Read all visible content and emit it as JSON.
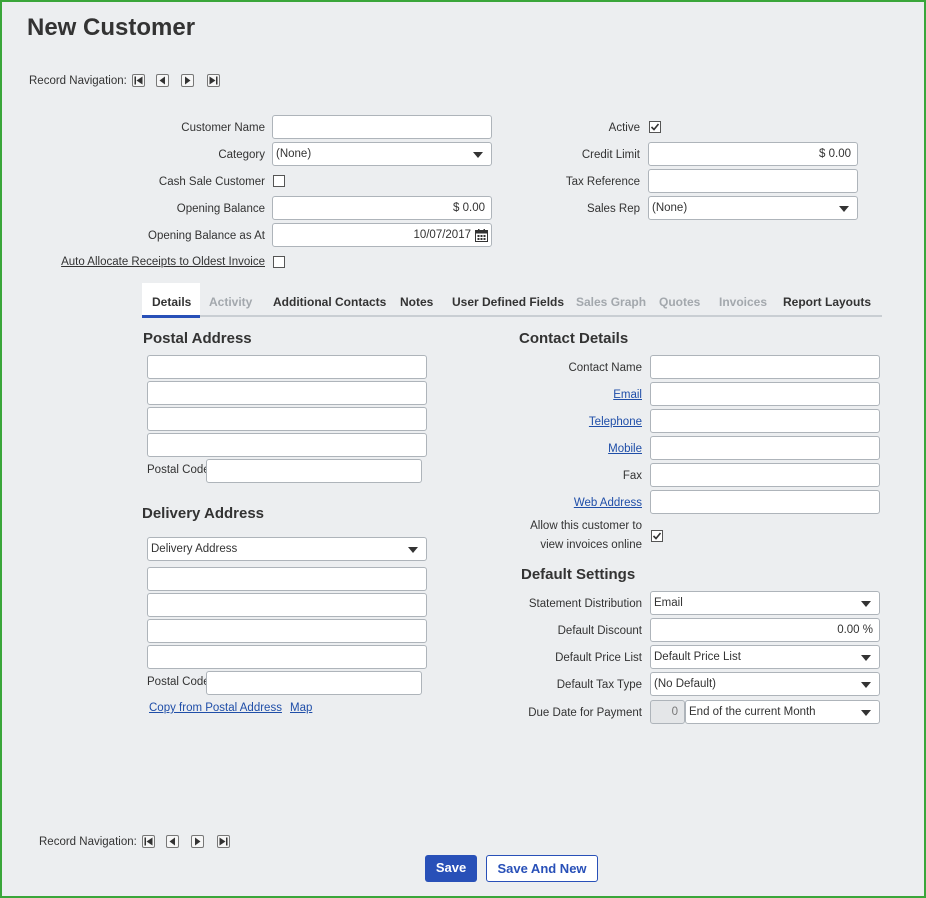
{
  "page": {
    "title": "New Customer"
  },
  "nav": {
    "label": "Record Navigation:"
  },
  "fields": {
    "customer_name": {
      "label": "Customer Name",
      "value": ""
    },
    "category": {
      "label": "Category",
      "value": "(None)"
    },
    "cash_sale": {
      "label": "Cash Sale Customer",
      "checked": false
    },
    "opening_balance": {
      "label": "Opening Balance",
      "value": "$ 0.00"
    },
    "opening_balance_date": {
      "label": "Opening Balance as At",
      "value": "10/07/2017"
    },
    "auto_allocate": {
      "label": "Auto Allocate Receipts to Oldest Invoice",
      "checked": false
    },
    "active": {
      "label": "Active",
      "checked": true
    },
    "credit_limit": {
      "label": "Credit Limit",
      "value": "$ 0.00"
    },
    "tax_reference": {
      "label": "Tax Reference",
      "value": ""
    },
    "sales_rep": {
      "label": "Sales Rep",
      "value": "(None)"
    }
  },
  "tabs": [
    {
      "label": "Details",
      "state": "active"
    },
    {
      "label": "Activity",
      "state": "disabled"
    },
    {
      "label": "Additional Contacts",
      "state": "enabled"
    },
    {
      "label": "Notes",
      "state": "enabled"
    },
    {
      "label": "User Defined Fields",
      "state": "enabled"
    },
    {
      "label": "Sales Graph",
      "state": "disabled"
    },
    {
      "label": "Quotes",
      "state": "disabled"
    },
    {
      "label": "Invoices",
      "state": "disabled"
    },
    {
      "label": "Report Layouts",
      "state": "enabled"
    }
  ],
  "postal": {
    "heading": "Postal Address",
    "postal_code_label": "Postal Code"
  },
  "delivery": {
    "heading": "Delivery Address",
    "select_value": "Delivery Address",
    "postal_code_label": "Postal Code",
    "copy_link": "Copy from Postal Address",
    "map_link": "Map"
  },
  "contact": {
    "heading": "Contact Details",
    "contact_name": "Contact Name",
    "email": "Email",
    "telephone": "Telephone",
    "mobile": "Mobile",
    "fax": "Fax",
    "web_address": "Web Address",
    "allow_online_line1": "Allow this customer to",
    "allow_online_line2": "view invoices online",
    "allow_online_checked": true
  },
  "defaults": {
    "heading": "Default Settings",
    "statement_distribution": {
      "label": "Statement Distribution",
      "value": "Email"
    },
    "default_discount": {
      "label": "Default Discount",
      "value": "0.00 %"
    },
    "default_price_list": {
      "label": "Default Price List",
      "value": "Default Price List"
    },
    "default_tax_type": {
      "label": "Default Tax Type",
      "value": "(No Default)"
    },
    "due_date": {
      "label": "Due Date for Payment",
      "days": "0",
      "value": "End of the current Month"
    }
  },
  "buttons": {
    "save": "Save",
    "save_and_new": "Save And New"
  },
  "colors": {
    "accent": "#2850b8",
    "link": "#1f4ea8",
    "frame": "#3aa63a",
    "background": "#eceef0"
  }
}
